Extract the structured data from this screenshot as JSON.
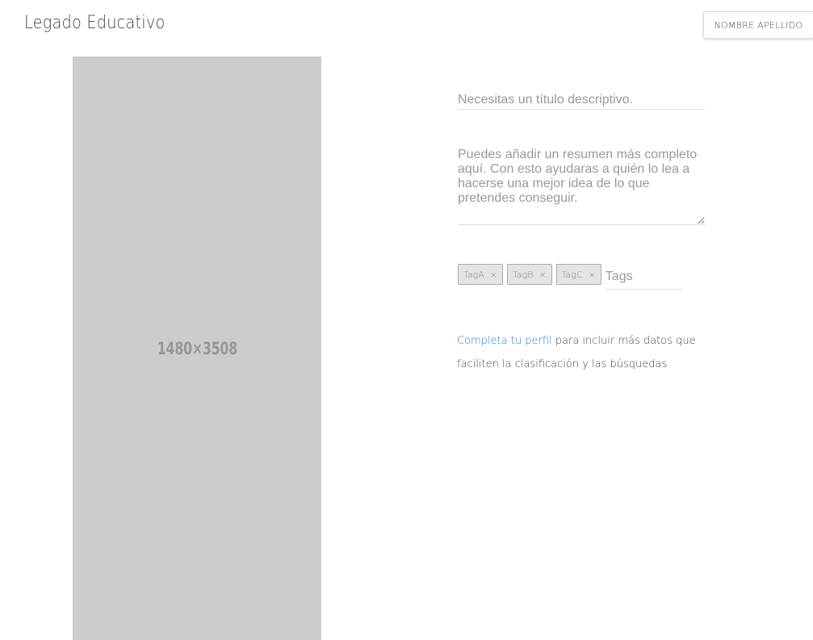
{
  "header": {
    "brand": "Legado Educativo",
    "user_button": "Nombre Apellido"
  },
  "preview": {
    "label": "1480×3508"
  },
  "form": {
    "title_placeholder": "Necesitas un título descriptivo.",
    "title_value": "",
    "summary_placeholder": "Puedes añadir un resumen más completo aquí. Con esto ayudaras a quién lo lea a hacerse una mejor idea de lo que pretendes conseguir.",
    "summary_value": "",
    "tags": [
      {
        "label": "TagA"
      },
      {
        "label": "TagB"
      },
      {
        "label": "TagC"
      }
    ],
    "tag_remove_glyph": "×",
    "tags_placeholder": "Tags"
  },
  "profile_hint": {
    "link": "Completa tu perfil",
    "text": " para incluir más datos que faciliten la clasificación y las búsquedas"
  }
}
